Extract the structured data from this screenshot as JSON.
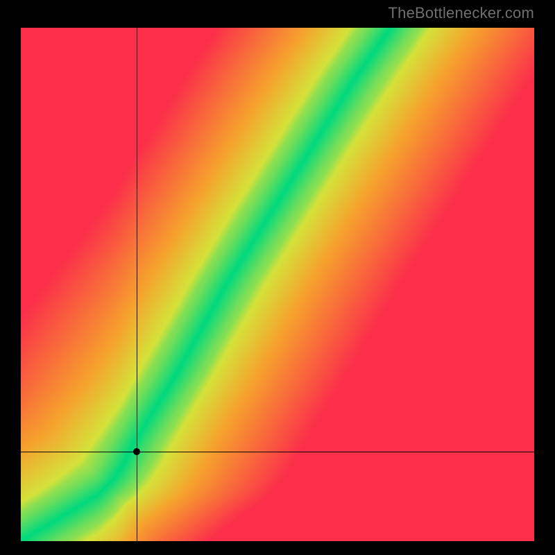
{
  "attribution": "TheBottlenecker.com",
  "chart_data": {
    "type": "heatmap",
    "title": "",
    "xlabel": "",
    "ylabel": "",
    "xlim": [
      0,
      1
    ],
    "ylim": [
      0,
      1
    ],
    "color_scale": {
      "description": "green at optimal ridge, through yellow, to red far from ridge",
      "stops": [
        {
          "t": 0.0,
          "color": "#00d97e"
        },
        {
          "t": 0.18,
          "color": "#d5e23a"
        },
        {
          "t": 0.45,
          "color": "#f6a22d"
        },
        {
          "t": 1.0,
          "color": "#fb2f4a"
        }
      ]
    },
    "optimal_curve": {
      "comment": "approximate ridge y = f(x), normalized 0..1, origin at bottom-left",
      "points": [
        {
          "x": 0.0,
          "y": 0.0
        },
        {
          "x": 0.05,
          "y": 0.03
        },
        {
          "x": 0.1,
          "y": 0.06
        },
        {
          "x": 0.15,
          "y": 0.09
        },
        {
          "x": 0.18,
          "y": 0.12
        },
        {
          "x": 0.2,
          "y": 0.15
        },
        {
          "x": 0.22,
          "y": 0.19
        },
        {
          "x": 0.25,
          "y": 0.24
        },
        {
          "x": 0.3,
          "y": 0.32
        },
        {
          "x": 0.35,
          "y": 0.41
        },
        {
          "x": 0.4,
          "y": 0.5
        },
        {
          "x": 0.45,
          "y": 0.58
        },
        {
          "x": 0.5,
          "y": 0.66
        },
        {
          "x": 0.55,
          "y": 0.74
        },
        {
          "x": 0.6,
          "y": 0.82
        },
        {
          "x": 0.65,
          "y": 0.9
        },
        {
          "x": 0.7,
          "y": 0.97
        },
        {
          "x": 0.72,
          "y": 1.0
        }
      ]
    },
    "band_half_width": 0.045,
    "crosshair": {
      "x": 0.225,
      "y": 0.175
    },
    "marker": {
      "x": 0.225,
      "y": 0.175
    }
  }
}
